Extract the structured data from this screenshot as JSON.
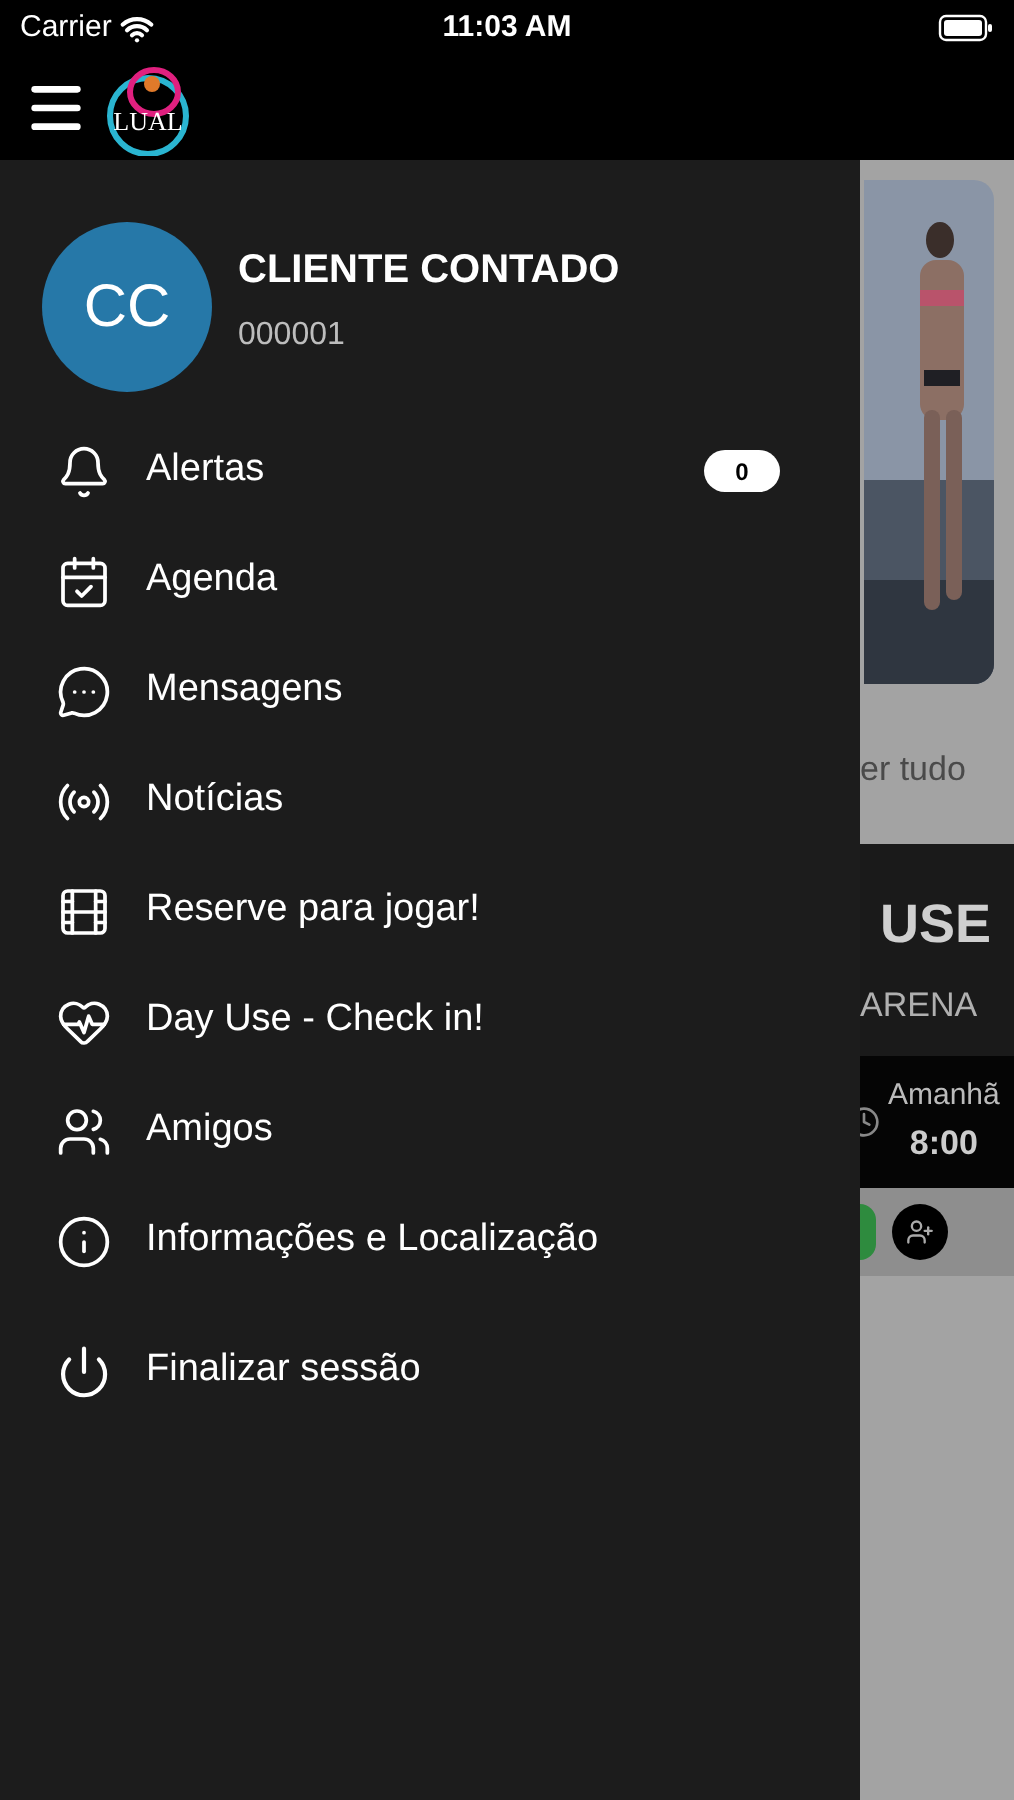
{
  "status_bar": {
    "carrier": "Carrier",
    "time": "11:03 AM"
  },
  "header": {
    "logo_text": "LUAL"
  },
  "profile": {
    "initials": "CC",
    "name": "CLIENTE CONTADO",
    "code": "000001"
  },
  "menu": [
    {
      "label": "Alertas",
      "badge": "0"
    },
    {
      "label": "Agenda"
    },
    {
      "label": "Mensagens"
    },
    {
      "label": "Notícias"
    },
    {
      "label": "Reserve para jogar!"
    },
    {
      "label": "Day Use - Check in!"
    },
    {
      "label": "Amigos"
    },
    {
      "label": "Informações e Localização"
    }
  ],
  "logout": {
    "label": "Finalizar sessão"
  },
  "background_page": {
    "see_all": "er tudo",
    "card_title": "USE",
    "card_subtitle": "ARENA",
    "slot_day": "Amanhã",
    "slot_time": "8:00"
  }
}
